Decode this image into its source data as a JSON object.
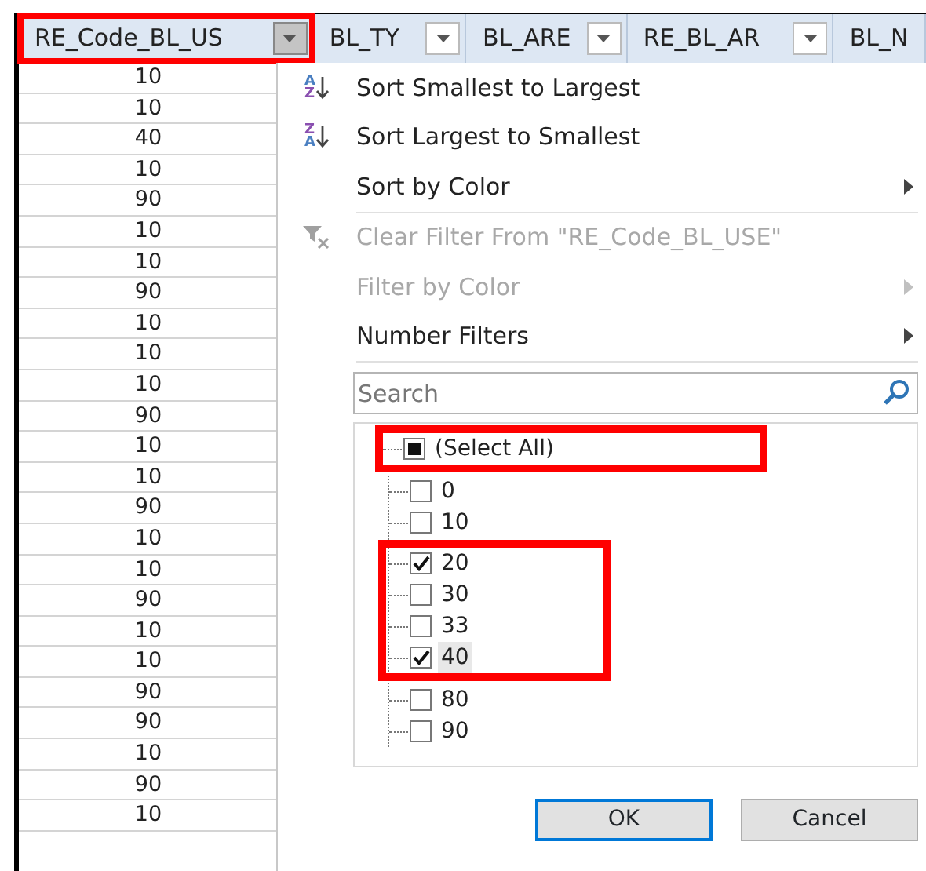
{
  "columns": [
    {
      "label": "RE_Code_BL_US",
      "highlighted": true,
      "pressed": true
    },
    {
      "label": "BL_TY",
      "highlighted": false,
      "pressed": false
    },
    {
      "label": "BL_ARE",
      "highlighted": false,
      "pressed": false
    },
    {
      "label": "RE_BL_AR",
      "highlighted": false,
      "pressed": false
    },
    {
      "label": "BL_N",
      "highlighted": false
    }
  ],
  "cells": [
    "10",
    "10",
    "40",
    "10",
    "90",
    "10",
    "10",
    "90",
    "10",
    "10",
    "10",
    "90",
    "10",
    "10",
    "90",
    "10",
    "10",
    "90",
    "10",
    "10",
    "90",
    "90",
    "10",
    "90",
    "10"
  ],
  "menu": [
    {
      "kind": "sort-asc",
      "label": "Sort Smallest to Largest",
      "icon_letters": [
        "A",
        "Z"
      ],
      "disabled": false,
      "submenu": false
    },
    {
      "kind": "sort-desc",
      "label": "Sort Largest to Smallest",
      "icon_letters": [
        "Z",
        "A"
      ],
      "disabled": false,
      "submenu": false
    },
    {
      "kind": "plain",
      "label": "Sort by Color",
      "disabled": false,
      "submenu": true
    },
    {
      "kind": "separator"
    },
    {
      "kind": "clear-filter",
      "label": "Clear Filter From \"RE_Code_BL_USE\"",
      "disabled": true,
      "submenu": false
    },
    {
      "kind": "plain",
      "label": "Filter by Color",
      "disabled": true,
      "submenu": true
    },
    {
      "kind": "plain",
      "label": "Number Filters",
      "disabled": false,
      "submenu": true
    },
    {
      "kind": "separator"
    }
  ],
  "search": {
    "placeholder": "Search"
  },
  "select_all": {
    "label": "(Select All)",
    "indeterminate": true,
    "highlighted": true
  },
  "values": [
    {
      "label": "0",
      "checked": false,
      "highlighted": false,
      "hovered": false
    },
    {
      "label": "10",
      "checked": false,
      "highlighted": false,
      "hovered": false
    },
    {
      "label": "20",
      "checked": true,
      "highlighted": true,
      "hovered": false
    },
    {
      "label": "30",
      "checked": false,
      "highlighted": true,
      "hovered": false
    },
    {
      "label": "33",
      "checked": false,
      "highlighted": true,
      "hovered": false
    },
    {
      "label": "40",
      "checked": true,
      "highlighted": true,
      "hovered": true
    },
    {
      "label": "80",
      "checked": false,
      "highlighted": false,
      "hovered": false
    },
    {
      "label": "90",
      "checked": false,
      "highlighted": false,
      "hovered": false
    }
  ],
  "buttons": [
    {
      "label": "OK",
      "default": true
    },
    {
      "label": "Cancel",
      "default": false
    }
  ]
}
